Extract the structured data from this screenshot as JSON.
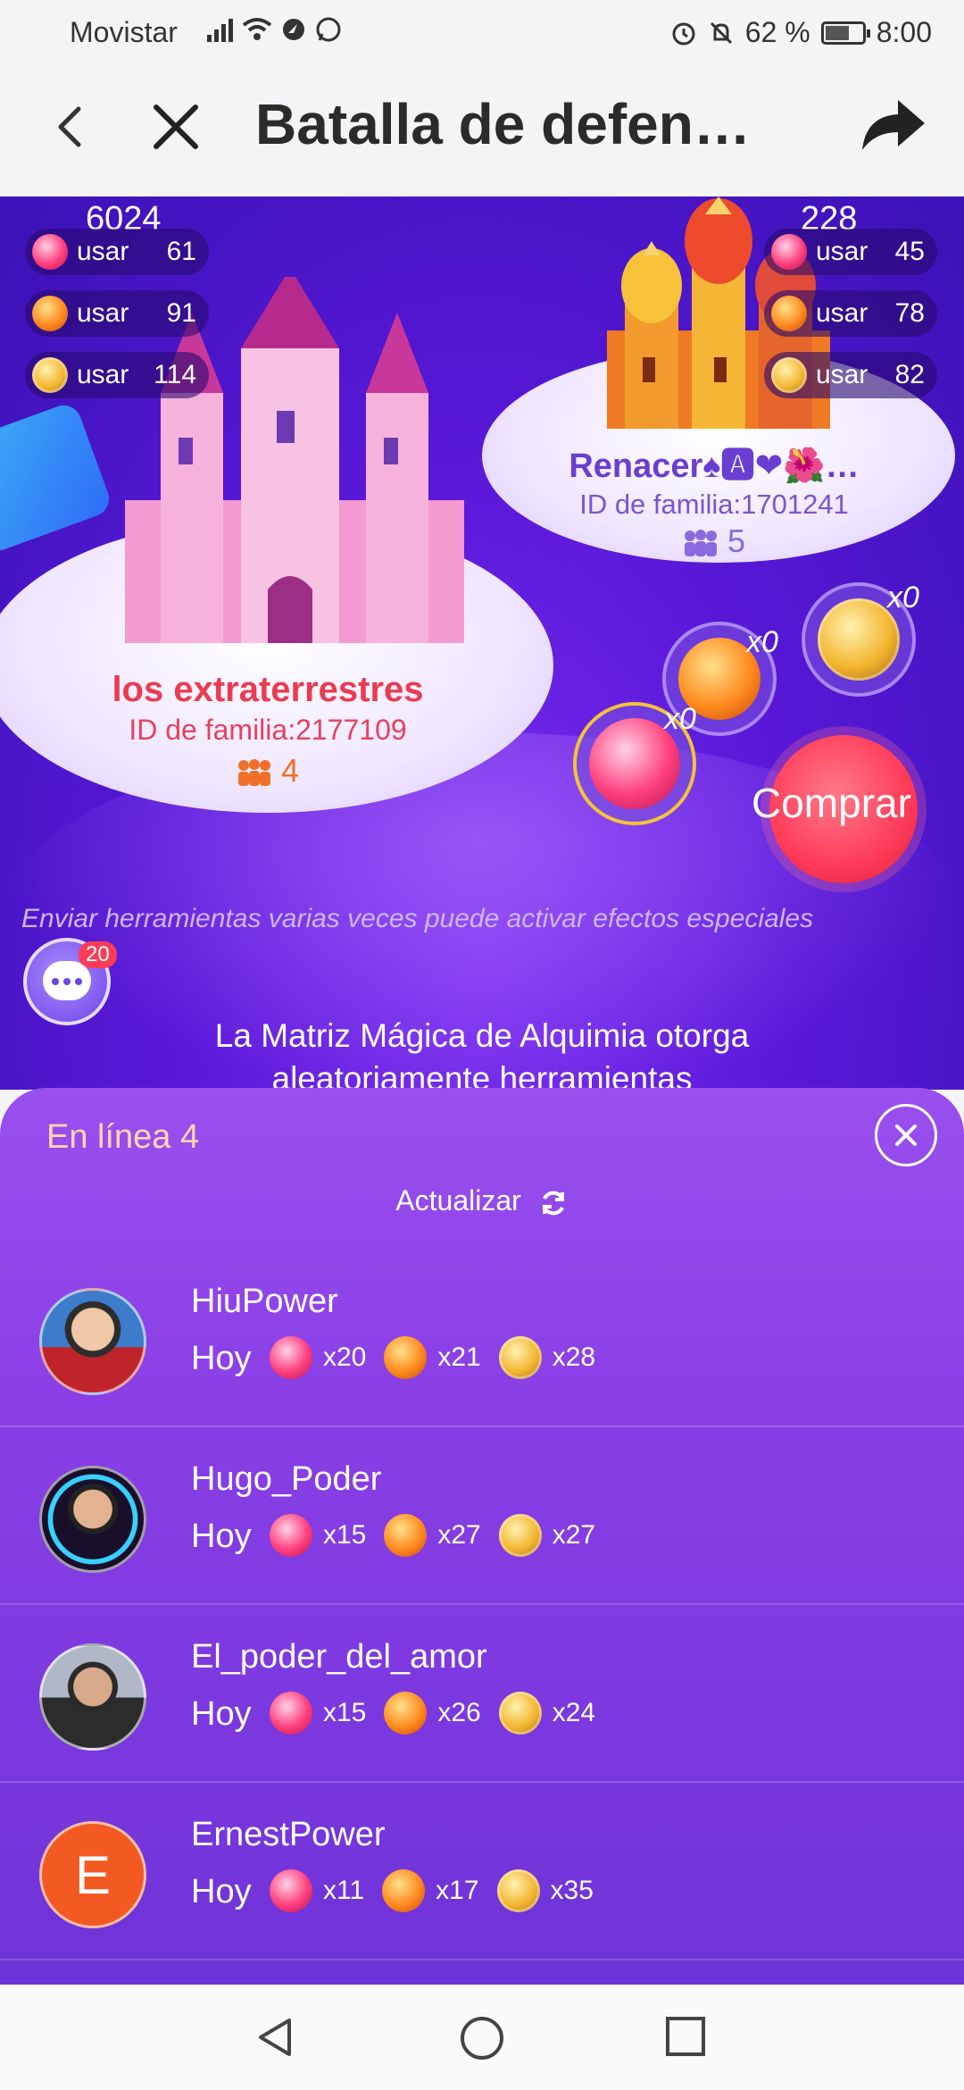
{
  "status_bar": {
    "carrier": "Movistar",
    "battery": "62 %",
    "time": "8:00"
  },
  "app_bar": {
    "title": "Batalla de defen…"
  },
  "game": {
    "left_score": "6024",
    "right_score": "228",
    "left_uses": [
      {
        "icon": "gem-icon",
        "label": "usar",
        "value": "61"
      },
      {
        "icon": "book-icon",
        "label": "usar",
        "value": "91"
      },
      {
        "icon": "ball-icon",
        "label": "usar",
        "value": "114"
      }
    ],
    "right_uses": [
      {
        "icon": "gem-icon",
        "label": "usar",
        "value": "45"
      },
      {
        "icon": "book-icon",
        "label": "usar",
        "value": "78"
      },
      {
        "icon": "ball-icon",
        "label": "usar",
        "value": "82"
      }
    ],
    "left_family": {
      "name": "los extraterrestres",
      "id": "ID de familia:2177109",
      "members": "4"
    },
    "right_family": {
      "name": "Renacer♠🅰❤🌺…",
      "id": "ID de familia:1701241",
      "members": "5"
    },
    "tools": [
      {
        "icon": "gem-icon",
        "count": "x0"
      },
      {
        "icon": "book-icon",
        "count": "x0"
      },
      {
        "icon": "ball-icon",
        "count": "x0"
      }
    ],
    "buy_label": "Comprar",
    "hint": "Enviar herramientas varias veces puede activar efectos especiales",
    "chat_badge": "20",
    "alchemy_text": "La Matriz Mágica de Alquimia otorga aleatoriamente herramientas"
  },
  "sheet": {
    "online_label": "En línea 4",
    "refresh_label": "Actualizar",
    "users": [
      {
        "name": "HiuPower",
        "day": "Hoy",
        "gem": "x20",
        "book": "x21",
        "ball": "x28"
      },
      {
        "name": "Hugo_Poder",
        "day": "Hoy",
        "gem": "x15",
        "book": "x27",
        "ball": "x27"
      },
      {
        "name": "El_poder_del_amor",
        "day": "Hoy",
        "gem": "x15",
        "book": "x26",
        "ball": "x24"
      },
      {
        "name": "ErnestPower",
        "day": "Hoy",
        "gem": "x11",
        "book": "x17",
        "ball": "x35",
        "avatar_letter": "E"
      }
    ]
  },
  "colors": {
    "accent_purple": "#8a3fe6",
    "buy_red": "#ff3b58",
    "left_family_red": "#ea3b52",
    "online_orange": "#ffd7a8"
  }
}
